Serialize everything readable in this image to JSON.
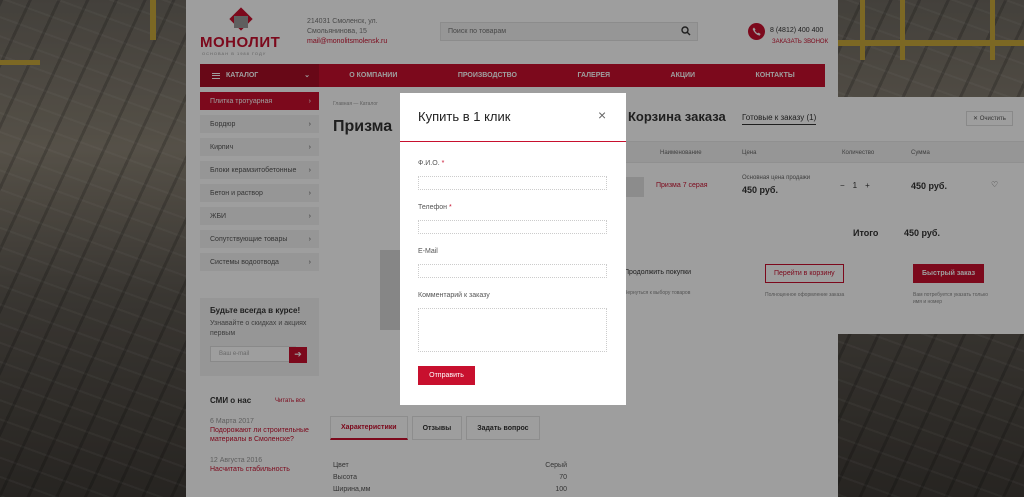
{
  "header": {
    "logo": {
      "word": "МОНОЛИТ",
      "slogan": "ОСНОВАН В 1988 ГОДУ"
    },
    "address_lines": [
      "214031 Смоленск, ул.",
      "Смольянинова, 15"
    ],
    "email": "mail@monolitsmolensk.ru",
    "search_placeholder": "Поиск по товарам",
    "phone": "8 (4812) 400 400",
    "callback": "ЗАКАЗАТЬ ЗВОНОК"
  },
  "nav": {
    "catalog": "КАТАЛОГ",
    "items": [
      "О КОМПАНИИ",
      "ПРОИЗВОДСТВО",
      "ГАЛЕРЕЯ",
      "АКЦИИ",
      "КОНТАКТЫ"
    ]
  },
  "sidebar": {
    "items": [
      "Плитка тротуарная",
      "Бордюр",
      "Кирпич",
      "Блоки керамзитобетонные",
      "Бетон и раствор",
      "ЖБИ",
      "Сопутствующие товары",
      "Системы водоотвода"
    ]
  },
  "subscribe": {
    "title": "Будьте всегда в курсе!",
    "desc": "Узнавайте о скидках и акциях первым",
    "placeholder": "Ваш e-mail"
  },
  "smi": {
    "title": "СМИ о нас",
    "all": "Читать все",
    "news": [
      {
        "date": "6 Марта 2017",
        "title": "Подорожают ли строительные материалы в Смоленске?"
      },
      {
        "date": "12 Августа 2016",
        "title": "Насчитать стабильность"
      }
    ]
  },
  "breadcrumb": {
    "home": "Главная",
    "sep": "—",
    "catalog": "Каталог"
  },
  "page_title": "Призма",
  "product_tabs": [
    "Характеристики",
    "Отзывы",
    "Задать вопрос"
  ],
  "specs": [
    {
      "k": "Цвет",
      "v": "Серый"
    },
    {
      "k": "Высота",
      "v": "70"
    },
    {
      "k": "Ширина,мм",
      "v": "100"
    }
  ],
  "cart": {
    "title": "Корзина заказа",
    "tab": "Готовые к заказу",
    "tab_count": "(1)",
    "clear": "Очистить",
    "cols": [
      "Наименование",
      "Цена",
      "Количество",
      "Сумма"
    ],
    "item": {
      "name": "Призма 7 серая",
      "price_note": "Основная цена продажи",
      "price": "450 руб.",
      "qty": "1",
      "minus": "−",
      "plus": "+",
      "sum": "450 руб."
    },
    "total_label": "Итого",
    "total": "450 руб.",
    "continue": "Продолжить покупки",
    "continue_sub": "Вернуться к выбору товаров",
    "go_cart": "Перейти в корзину",
    "go_cart_sub": "Полноценное оформление заказа",
    "quick": "Быстрый заказ",
    "quick_sub": "Вам потребуется указать только имя и номер"
  },
  "modal": {
    "title": "Купить в 1 клик",
    "close": "×",
    "fields": [
      {
        "label": "Ф.И.О.",
        "req": "*"
      },
      {
        "label": "Телефон",
        "req": "*"
      },
      {
        "label": "E-Mail",
        "req": ""
      },
      {
        "label": "Комментарий к заказу",
        "req": ""
      }
    ],
    "submit": "Отправить"
  },
  "colors": {
    "brand": "#c8102e"
  }
}
